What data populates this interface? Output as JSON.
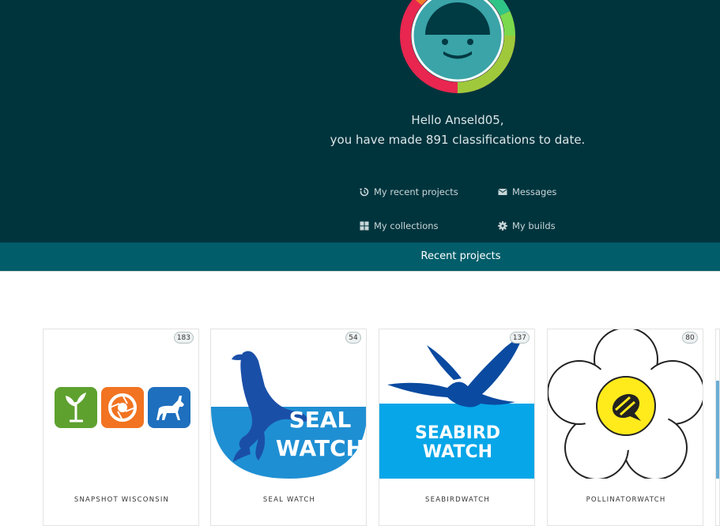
{
  "user": {
    "greeting": "Hello Anseld05,",
    "classifications_line": "you have made 891 classifications to date."
  },
  "nav": {
    "recent_projects": "My recent projects",
    "messages": "Messages",
    "collections": "My collections",
    "builds": "My builds"
  },
  "section_bar": {
    "label": "Recent projects"
  },
  "projects": [
    {
      "name": "SNAPSHOT WISCONSIN",
      "count": "183"
    },
    {
      "name": "SEAL WATCH",
      "count": "54",
      "logo_text_1": "SEAL",
      "logo_text_2": "WATCH"
    },
    {
      "name": "SEABIRDWATCH",
      "count": "137",
      "logo_text_1": "SEABIRD",
      "logo_text_2": "WATCH"
    },
    {
      "name": "POLLINATORWATCH",
      "count": "80"
    }
  ],
  "colors": {
    "hero_bg": "#00343d",
    "bar_bg": "#005d69",
    "avatar_face": "#3aa4a8"
  }
}
